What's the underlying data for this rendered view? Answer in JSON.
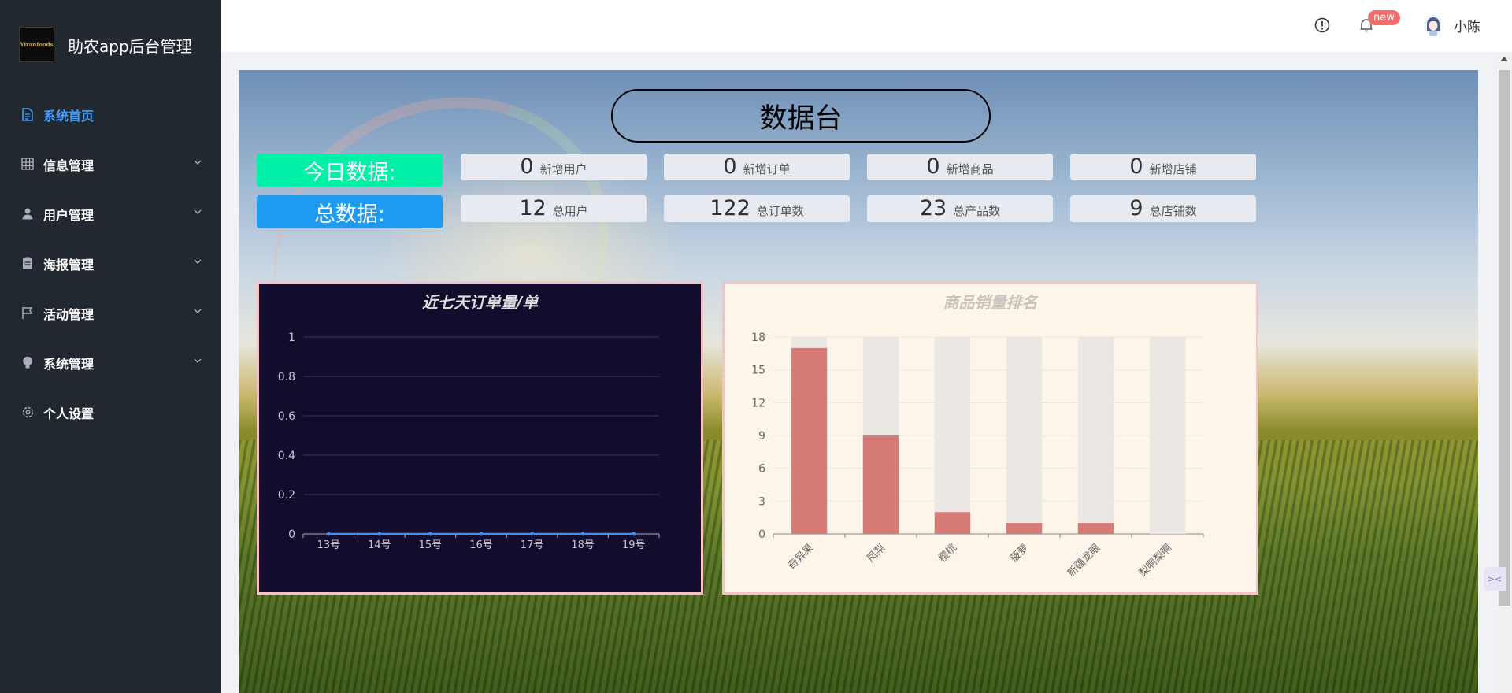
{
  "app": {
    "title": "助农app后台管理",
    "logo_text": "Yiranfoods"
  },
  "sidebar": {
    "items": [
      {
        "label": "系统首页",
        "icon": "document-icon",
        "active": true,
        "expandable": false
      },
      {
        "label": "信息管理",
        "icon": "grid-icon",
        "active": false,
        "expandable": true
      },
      {
        "label": "用户管理",
        "icon": "user-icon",
        "active": false,
        "expandable": true
      },
      {
        "label": "海报管理",
        "icon": "clipboard-icon",
        "active": false,
        "expandable": true
      },
      {
        "label": "活动管理",
        "icon": "flag-icon",
        "active": false,
        "expandable": true
      },
      {
        "label": "系统管理",
        "icon": "bulb-icon",
        "active": false,
        "expandable": true
      },
      {
        "label": "个人设置",
        "icon": "gear-icon",
        "active": false,
        "expandable": false
      }
    ]
  },
  "header": {
    "badge": "new",
    "user_name": "小陈"
  },
  "dashboard": {
    "title": "数据台",
    "today_label": "今日数据:",
    "total_label": "总数据:",
    "today": [
      {
        "value": "0",
        "label": "新增用户"
      },
      {
        "value": "0",
        "label": "新增订单"
      },
      {
        "value": "0",
        "label": "新增商品"
      },
      {
        "value": "0",
        "label": "新增店铺"
      }
    ],
    "total": [
      {
        "value": "12",
        "label": "总用户"
      },
      {
        "value": "122",
        "label": "总订单数"
      },
      {
        "value": "23",
        "label": "总产品数"
      },
      {
        "value": "9",
        "label": "总店铺数"
      }
    ]
  },
  "colors": {
    "sidebar_bg": "#222830",
    "active": "#409eff",
    "today_label_bg": "#00f0a8",
    "total_label_bg": "#1e9bf0",
    "line_chart_bg": "#130c2c",
    "bar_chart_bg": "#fdf5ea",
    "bar_fill": "#d67b78",
    "bar_shadow": "#ebe8e3",
    "line_color": "#3e8ef7"
  },
  "chart_data": [
    {
      "type": "line",
      "title": "近七天订单量/单",
      "categories": [
        "13号",
        "14号",
        "15号",
        "16号",
        "17号",
        "18号",
        "19号"
      ],
      "values": [
        0,
        0,
        0,
        0,
        0,
        0,
        0
      ],
      "ylim": [
        0,
        1
      ],
      "yticks": [
        "0",
        "0.2",
        "0.4",
        "0.6",
        "0.8",
        "1"
      ],
      "grid": true
    },
    {
      "type": "bar",
      "title": "商品销量排名",
      "categories": [
        "奇异果",
        "凤梨",
        "樱桃",
        "菠萝",
        "新疆龙眼",
        "梨啊梨啊"
      ],
      "values": [
        17,
        9,
        2,
        1,
        1,
        0
      ],
      "ylim": [
        0,
        18
      ],
      "yticks": [
        "0",
        "3",
        "6",
        "9",
        "12",
        "15",
        "18"
      ],
      "background_bars": true,
      "grid": true
    }
  ]
}
